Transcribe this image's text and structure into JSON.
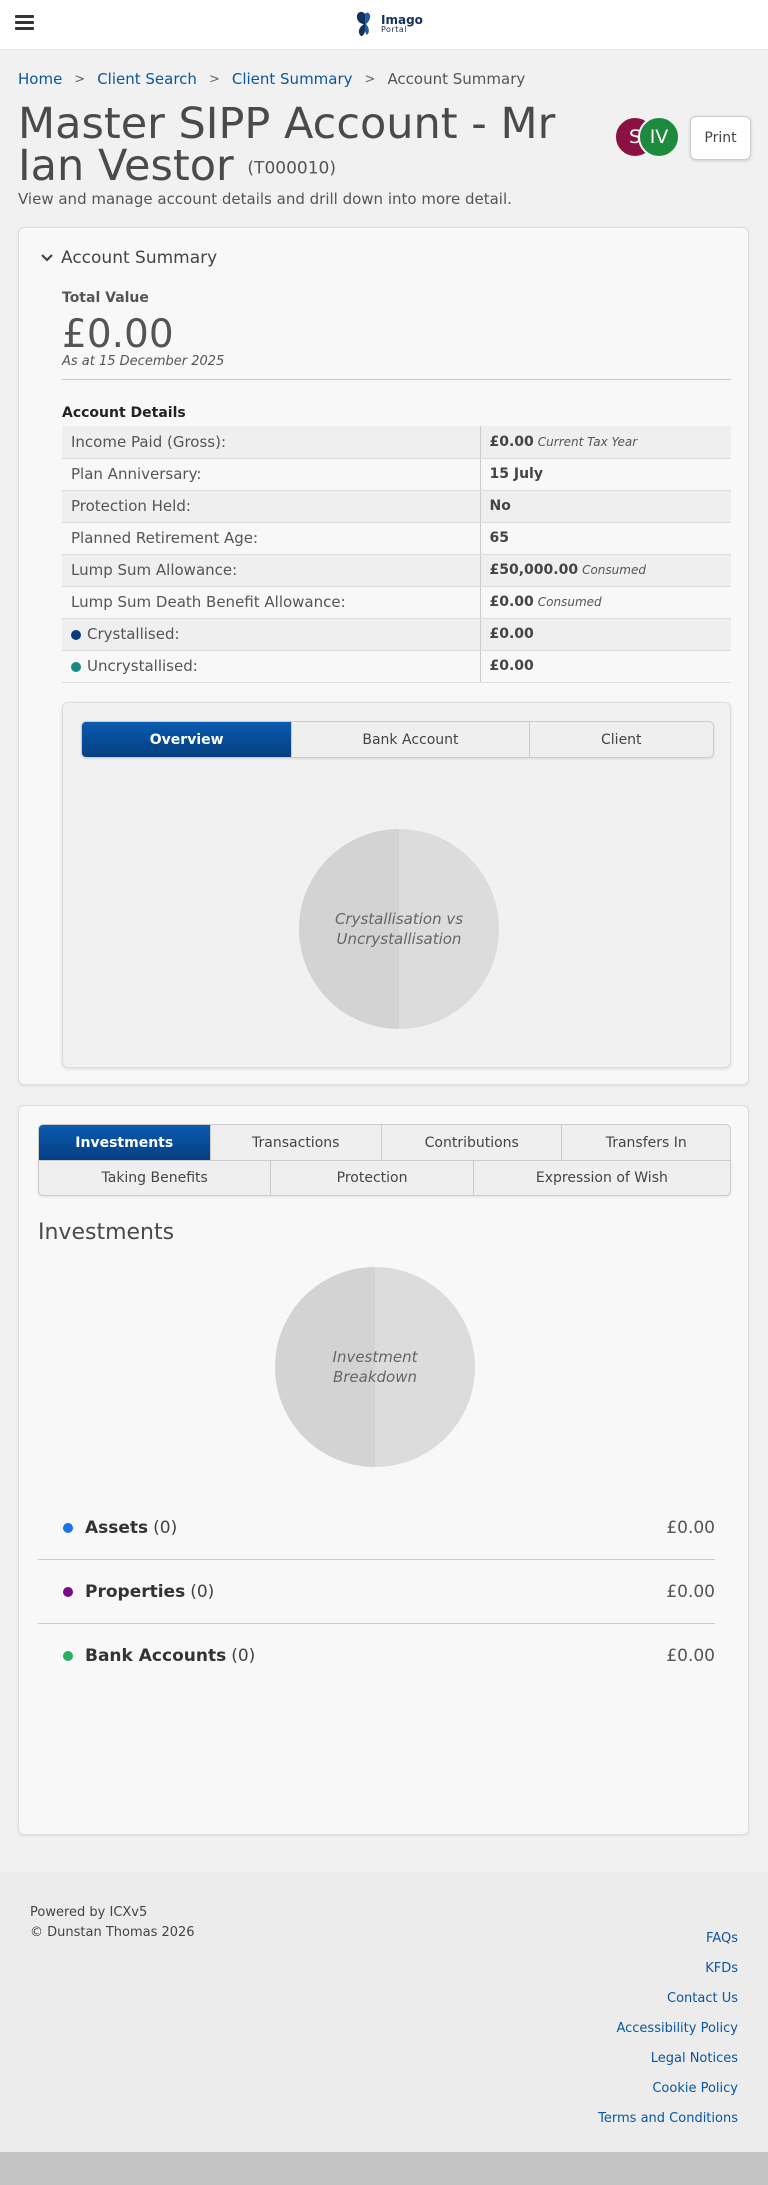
{
  "header": {
    "logo_text_line1": "Imago",
    "logo_text_line2": "Portal"
  },
  "breadcrumb": {
    "items": [
      "Home",
      "Client Search",
      "Client Summary"
    ],
    "current": "Account Summary",
    "separator": ">"
  },
  "page": {
    "title": "Master SIPP Account - Mr Ian Vestor",
    "ref": "(T000010)",
    "subtitle": "View and manage account details and drill down into more detail.",
    "print_label": "Print",
    "avatars": [
      {
        "initials": "S",
        "color": "#8b1142"
      },
      {
        "initials": "IV",
        "color": "#1e8a3e"
      }
    ]
  },
  "account_summary": {
    "header": "Account Summary",
    "total_label": "Total Value",
    "total_value": "£0.00",
    "as_at": "As at 15 December 2025",
    "details_title": "Account Details",
    "details": [
      {
        "label": "Income Paid (Gross):",
        "value": "£0.00",
        "note": "Current Tax Year"
      },
      {
        "label": "Plan Anniversary:",
        "value": "15 July",
        "note": ""
      },
      {
        "label": "Protection Held:",
        "value": "No",
        "note": ""
      },
      {
        "label": "Planned Retirement Age:",
        "value": "65",
        "note": ""
      },
      {
        "label": "Lump Sum Allowance:",
        "value": "£50,000.00",
        "note": "Consumed"
      },
      {
        "label": "Lump Sum Death Benefit Allowance:",
        "value": "£0.00",
        "note": "Consumed"
      },
      {
        "label": "Crystallised:",
        "value": "£0.00",
        "note": "",
        "dot_color": "#0a3d80"
      },
      {
        "label": "Uncrystallised:",
        "value": "£0.00",
        "note": "",
        "dot_color": "#168a8a"
      }
    ],
    "tabs": [
      "Overview",
      "Bank Account",
      "Client"
    ],
    "active_tab": "Overview",
    "pie_label": "Crystallisation vs Uncrystallisation"
  },
  "investments_card": {
    "tabs_row1": [
      "Investments",
      "Transactions",
      "Contributions",
      "Transfers In"
    ],
    "tabs_row2": [
      "Taking Benefits",
      "Protection",
      "Expression of Wish"
    ],
    "active_tab": "Investments",
    "title": "Investments",
    "pie_label": "Investment Breakdown",
    "rows": [
      {
        "name": "Assets",
        "count": "(0)",
        "amount": "£0.00",
        "dot_color": "#1a73e8"
      },
      {
        "name": "Properties",
        "count": "(0)",
        "amount": "£0.00",
        "dot_color": "#7b0a8c"
      },
      {
        "name": "Bank Accounts",
        "count": "(0)",
        "amount": "£0.00",
        "dot_color": "#27ae60"
      }
    ]
  },
  "footer": {
    "powered_by": "Powered by ICXv5",
    "copyright": "© Dunstan Thomas 2026",
    "links": [
      "FAQs",
      "KFDs",
      "Contact Us",
      "Accessibility Policy",
      "Legal Notices",
      "Cookie Policy",
      "Terms and Conditions"
    ]
  }
}
